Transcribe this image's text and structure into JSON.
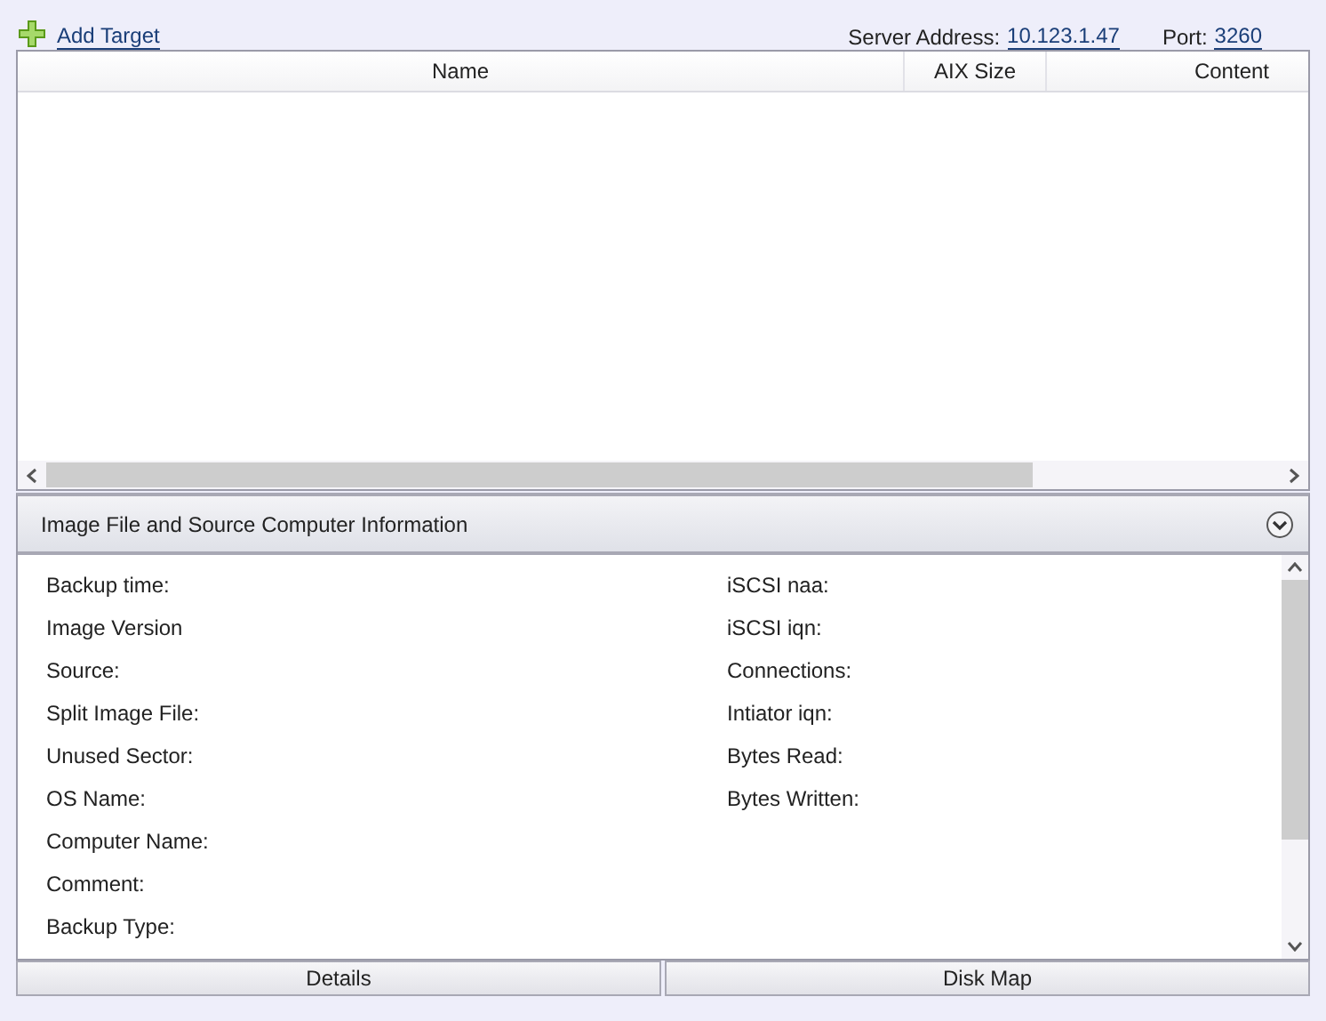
{
  "toolbar": {
    "add_target": "Add Target",
    "server_address_label": "Server Address:",
    "server_address": "10.123.1.47",
    "port_label": "Port:",
    "port": "3260"
  },
  "table": {
    "columns": [
      "Name",
      "AIX Size",
      "Content"
    ]
  },
  "info_panel": {
    "title": "Image File and Source Computer Information",
    "left_fields": [
      "Backup time:",
      "Image Version",
      "Source:",
      "Split Image File:",
      "Unused Sector:",
      "OS Name:",
      "Computer Name:",
      "Comment:",
      "Backup Type:"
    ],
    "right_fields": [
      "iSCSI naa:",
      "iSCSI iqn:",
      "Connections:",
      "Intiator iqn:",
      "Bytes Read:",
      "Bytes Written:"
    ]
  },
  "tabs": [
    "Details",
    "Disk Map"
  ]
}
